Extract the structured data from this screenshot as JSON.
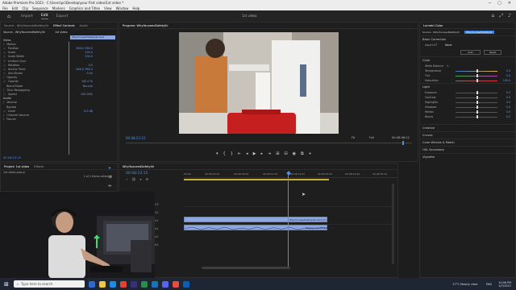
{
  "window": {
    "title": "Adobe Premiere Pro 2023 - C:\\Users\\pc\\Desktop\\your first video\\1st video *",
    "controls": [
      "─",
      "▢",
      "✕"
    ]
  },
  "menu": [
    "File",
    "Edit",
    "Clip",
    "Sequence",
    "Markers",
    "Graphics and Titles",
    "View",
    "Window",
    "Help"
  ],
  "header": {
    "tabs": [
      {
        "label": "Import",
        "active": false
      },
      {
        "label": "Edit",
        "active": true
      },
      {
        "label": "Export",
        "active": false
      }
    ],
    "center_label": "1st video",
    "right_icons": [
      "home-icon",
      "fullscreen-icon",
      "bell-icon"
    ]
  },
  "source_panel": {
    "tabs": [
      "Source - WhyYouneedSafetyIllr",
      "Effect Controls",
      "Audio"
    ],
    "clip_label": "Source - WhyYouneedSafetyIllr",
    "sequence_label": "1st video",
    "clip_chip": "WhyYouneedSafetyIllr.mp4",
    "section_video": "Video",
    "rows": [
      {
        "label": "Motion"
      },
      {
        "label": "Position",
        "value": "640.0    360.0"
      },
      {
        "label": "Scale",
        "value": "100.0"
      },
      {
        "label": "Scale Width",
        "value": "100.0"
      },
      {
        "label": "Uniform Scal"
      },
      {
        "label": "Rotation",
        "value": "0.0"
      },
      {
        "label": "Anchor Point",
        "value": "640.0    360.0"
      },
      {
        "label": "Anti-flicker",
        "value": "0.00"
      },
      {
        "label": "Opacity"
      },
      {
        "label": "Opacity",
        "value": "100.0 %"
      },
      {
        "label": "Blend Mode",
        "value": "Normal"
      },
      {
        "label": "Time Remapping"
      },
      {
        "label": "Speed",
        "value": "100.00%"
      }
    ],
    "section_audio": "Audio",
    "audio_rows": [
      {
        "label": "Volume"
      },
      {
        "label": "Bypass"
      },
      {
        "label": "Level",
        "value": "0.0 dB"
      },
      {
        "label": "Channel Volume"
      },
      {
        "label": "Panner"
      }
    ],
    "timecode": "00:08:23:15"
  },
  "program_monitor": {
    "title": "Program: WhyYouneedSafetyIllr",
    "timecode": "00:08:23:15",
    "fit": "Fit",
    "quality": "Full",
    "duration": "00:08:46:22",
    "transport_icons": [
      "marker-icon",
      "in-icon",
      "out-icon",
      "go-to-in-icon",
      "step-back-icon",
      "play-icon",
      "step-forward-icon",
      "go-to-out-icon",
      "insert-icon",
      "overwrite-icon",
      "export-frame-icon",
      "compare-icon",
      "add-icon"
    ]
  },
  "project_panel": {
    "tabs": [
      "Project: 1st video",
      "Effects"
    ],
    "file_label": "1st video.prproj",
    "count_label": "1 of 2 items selected"
  },
  "timeline": {
    "sequence_tab": "WhyYouneedSafetyIllr",
    "timecode": "00:08:23:15",
    "ruler_labels": [
      "00:00",
      "00:08:04:22",
      "00:08:09:22",
      "00:08:14:22",
      "00:08:19:22",
      "00:08:24:22",
      "00:08:29:22",
      "00:08:34:22"
    ],
    "tracks": [
      "V3",
      "V2",
      "V1",
      "A1",
      "A2",
      "A3"
    ],
    "video_clip_label": "WhyYouneedSafetyIllr.mp4 [V]",
    "audio_clip_label": "WhyYouneedSafetyIllr.mp4",
    "tool_icons": [
      "selection-tool-icon",
      "track-select-icon",
      "ripple-edit-icon",
      "razor-icon",
      "slip-icon",
      "pen-icon",
      "hand-icon",
      "type-icon"
    ]
  },
  "lumetri": {
    "title": "Lumetri Color",
    "clip_tab": "Source - WhyYouneedSafetyIllr",
    "clip_tab2": "WhyYouneedSafetyIllr",
    "basic_correction": "Basic Correction",
    "input_lut_label": "Input LUT",
    "input_lut_value": "None",
    "auto_label": "Auto",
    "reset_label": "Reset",
    "color_section": "Color",
    "white_balance": "White Balance",
    "color_rows": [
      {
        "label": "Temperature",
        "value": "0.0"
      },
      {
        "label": "Tint",
        "value": "0.0"
      },
      {
        "label": "Saturation",
        "value": "100.0"
      }
    ],
    "light_section": "Light",
    "light_rows": [
      {
        "label": "Exposure",
        "value": "0.0"
      },
      {
        "label": "Contrast",
        "value": "0.0"
      },
      {
        "label": "Highlights",
        "value": "0.0"
      },
      {
        "label": "Shadows",
        "value": "0.0"
      },
      {
        "label": "Whites",
        "value": "0.0"
      },
      {
        "label": "Blacks",
        "value": "0.0"
      }
    ],
    "sections": [
      "Creative",
      "Curves",
      "Color Wheels & Match",
      "HSL Secondary",
      "Vignette"
    ]
  },
  "taskbar": {
    "search_placeholder": "Type here to search",
    "weather": "17°C  Mostly clear",
    "time": "10:06 PM",
    "date": "4/7/2023",
    "lang": "ENG"
  },
  "colors": {
    "accent_blue": "#3c82dc",
    "clip_blue": "#8da8e0",
    "playhead": "#4e8fe6",
    "taskbar": "#1f2633"
  }
}
